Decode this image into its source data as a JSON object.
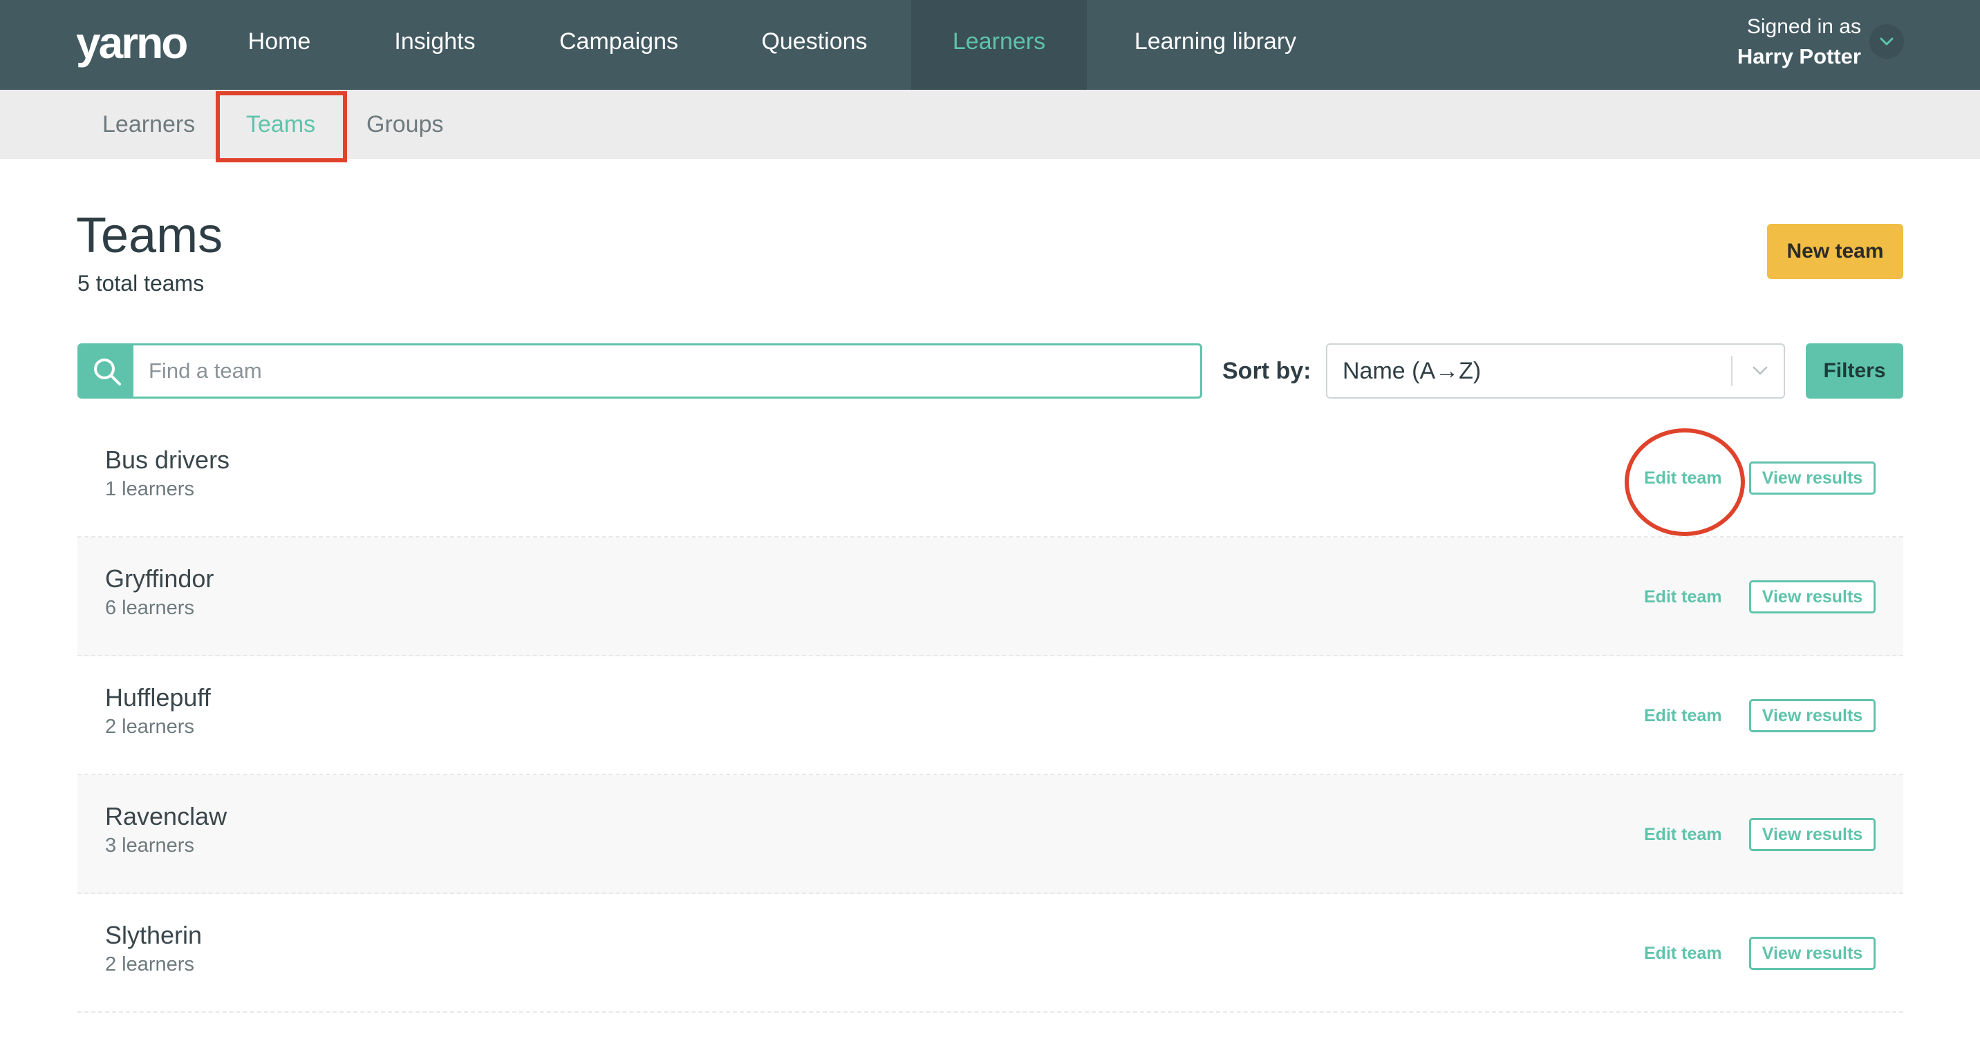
{
  "nav": {
    "logo": "yarno",
    "items": [
      {
        "label": "Home"
      },
      {
        "label": "Insights"
      },
      {
        "label": "Campaigns"
      },
      {
        "label": "Questions"
      },
      {
        "label": "Learners"
      },
      {
        "label": "Learning library"
      }
    ],
    "active": "Learners",
    "signed_in_label": "Signed in as",
    "user_name": "Harry Potter"
  },
  "subnav": {
    "items": [
      {
        "label": "Learners"
      },
      {
        "label": "Teams"
      },
      {
        "label": "Groups"
      }
    ],
    "active": "Teams"
  },
  "page": {
    "title": "Teams",
    "total": "5 total teams",
    "new_button": "New team"
  },
  "search": {
    "placeholder": "Find a team",
    "value": ""
  },
  "sort": {
    "label": "Sort by:",
    "value": "Name (A→Z)"
  },
  "filters_button": "Filters",
  "teams": [
    {
      "name": "Bus drivers",
      "count": "1 learners",
      "edit": "Edit team",
      "view": "View results"
    },
    {
      "name": "Gryffindor",
      "count": "6 learners",
      "edit": "Edit team",
      "view": "View results"
    },
    {
      "name": "Hufflepuff",
      "count": "2 learners",
      "edit": "Edit team",
      "view": "View results"
    },
    {
      "name": "Ravenclaw",
      "count": "3 learners",
      "edit": "Edit team",
      "view": "View results"
    },
    {
      "name": "Slytherin",
      "count": "2 learners",
      "edit": "Edit team",
      "view": "View results"
    }
  ],
  "colors": {
    "nav_bg": "#435a61",
    "accent": "#5fc3ab",
    "primary_button": "#f1bd44",
    "annotation": "#e0432b"
  }
}
